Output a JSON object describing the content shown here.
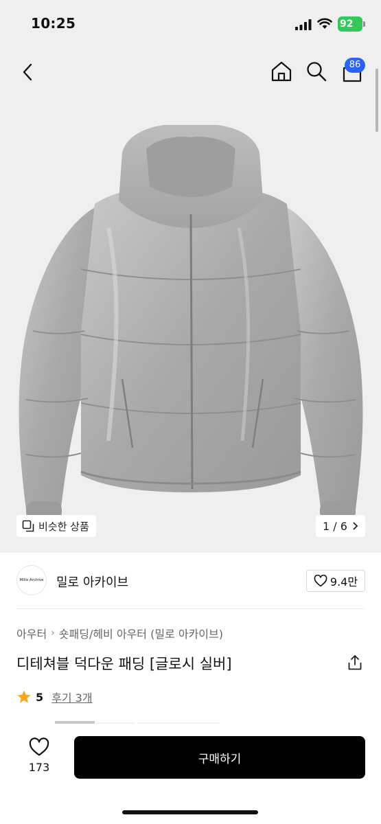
{
  "status_bar": {
    "time": "10:25",
    "battery": "92",
    "icons": [
      "signal-icon",
      "wifi-icon",
      "battery-icon"
    ]
  },
  "nav": {
    "icons": [
      "back-icon",
      "home-icon",
      "search-icon",
      "cart-icon"
    ],
    "cart_badge": "86"
  },
  "gallery": {
    "similar_label": "비슷한 상품",
    "counter": "1 / 6"
  },
  "seller": {
    "logo_text": "Millo Archive",
    "name": "밀로 아카이브",
    "follow_count": "9.4만"
  },
  "product": {
    "breadcrumb": [
      "아우터",
      "숏패딩/헤비 아우터 (밀로 아카이브)"
    ],
    "title": "디테쳐블 덕다운 패딩 [글로시 실버]",
    "rating": "5",
    "review_label": "후기 3개"
  },
  "bottom_bar": {
    "like_count": "173",
    "buy_label": "구매하기"
  },
  "colors": {
    "badge": "#2b63f6",
    "battery": "#34c759",
    "star": "#f5a623",
    "buy_button": "#000000"
  }
}
